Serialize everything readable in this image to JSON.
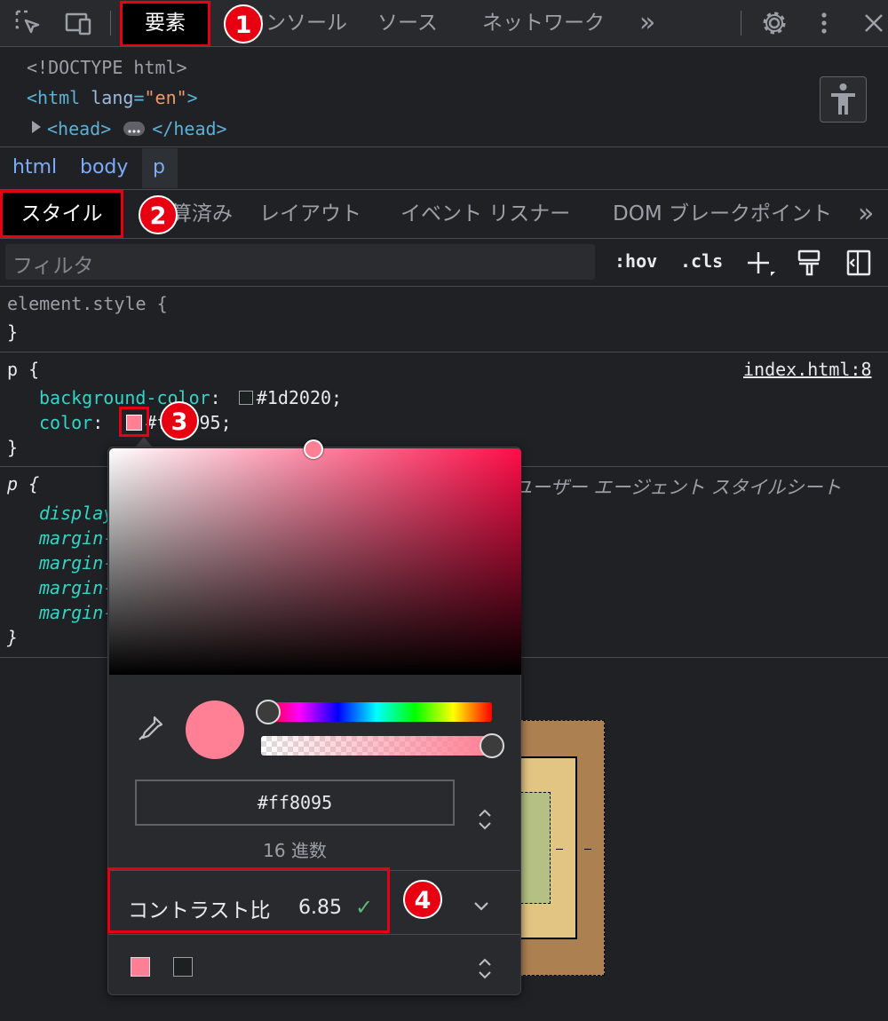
{
  "toolbar": {
    "tabs": [
      "要素",
      "コンソール",
      "ソース",
      "ネットワーク"
    ],
    "more_label": "»"
  },
  "dom": {
    "doctype": "<!DOCTYPE html>",
    "html_open_tag": "<html",
    "html_attr_name": "lang",
    "html_attr_value": "\"en\"",
    "html_close": ">",
    "head_open": "<head>",
    "head_close": "</head>"
  },
  "breadcrumb": [
    "html",
    "body",
    "p"
  ],
  "subtabs": [
    "スタイル",
    "計算済み",
    "レイアウト",
    "イベント リスナー",
    "DOM ブレークポイント"
  ],
  "filter": {
    "placeholder": "フィルタ",
    "hov": ":hov",
    "cls": ".cls"
  },
  "styles": {
    "element_style_selector": "element.style {",
    "close_brace": "}",
    "rule1": {
      "selector": "p {",
      "source": "index.html:8",
      "bg_prop": "background-color",
      "bg_value": "#1d2020;",
      "color_prop": "color",
      "color_value": "#ff8095;"
    },
    "rule2": {
      "selector": "p {",
      "source": "ユーザー エージェント スタイルシート",
      "props": [
        "display",
        "margin-block-start",
        "margin-block-end",
        "margin-inline-start",
        "margin-inline-end"
      ]
    }
  },
  "picker": {
    "hex_value": "#ff8095",
    "format_label": "16 進数",
    "contrast_label": "コントラスト比",
    "contrast_value": "6.85",
    "check_mark": "✓"
  },
  "annotations": [
    "1",
    "2",
    "3",
    "4"
  ],
  "colors": {
    "swatch": "#ff8095",
    "bg_swatch": "#1d2020",
    "annotation_red": "#e60012",
    "margin_box": "#ad8052",
    "border_box": "#e3c583",
    "padding_box": "#b5c184"
  }
}
